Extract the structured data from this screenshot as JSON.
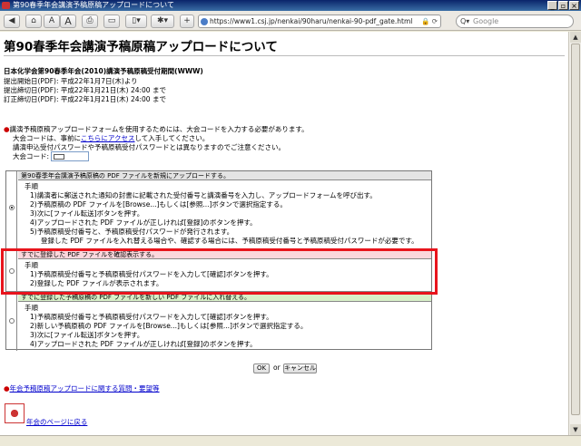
{
  "window": {
    "title": "第90春季年会講演予稿原稿アップロードについて",
    "controls": [
      "_",
      "▫",
      "×"
    ]
  },
  "toolbar": {
    "back": "◀",
    "home": "⌂",
    "font_small": "A",
    "font_large": "A",
    "print": "⎙",
    "bookmarks": "▭",
    "page": "▯▾",
    "settings": "✱▾",
    "add": "+",
    "url": "https://www1.csj.jp/nenkai/90haru/nenkai-90-pdf_gate.html",
    "url_right": "🔒 ⟳",
    "search_placeholder": "Google",
    "search_icon": "Q▾"
  },
  "page": {
    "title": "第90春季年会講演予稿原稿アップロードについて",
    "period_heading": "日本化学会第90春季年会(2010)講演予稿原稿受付期間(WWW)",
    "period_lines": [
      "提出開始日(PDF): 平成22年1月7日(木)より",
      "提出締切日(PDF): 平成22年1月21日(木) 24:00 まで",
      "訂正締切日(PDF): 平成22年1月21日(木) 24:00 まで"
    ],
    "notice_line1": "講演予稿原稿アップロードフォームを使用するためには、大会コードを入力する必要があります。",
    "notice_line2_pre": "大会コードは、事前に",
    "notice_line2_link": "こちらにアクセス",
    "notice_line2_post": "して入手してください。",
    "notice_line3": "講演申込受付パスワードや予稿原稿受付パスワードとは異なりますのでご注意ください。",
    "code_label": "大会コード:",
    "options": [
      {
        "header": "第90春季年会講演予稿原稿の PDF ファイルを新規にアップロードする。",
        "steps_title": "手順",
        "steps": [
          "1)講演者に郵送された通知の封書に記載された受付番号と講演番号を入力し、アップロードフォームを呼び出す。",
          "2)予稿原稿の PDF ファイルを[Browse...]もしくは[参照...]ボタンで選択指定する。",
          "3)次に[ファイル転送]ボタンを押す。",
          "4)アップロードされた PDF ファイルが正しければ[登録]のボタンを押す。",
          "5)予稿原稿受付番号と、予稿原稿受付パスワードが発行されます。",
          "登録した PDF ファイルを入れ替える場合や、確認する場合には、予稿原稿受付番号と予稿原稿受付パスワードが必要です。"
        ],
        "selected": true
      },
      {
        "header": "すでに登録した PDF ファイルを確認表示する。",
        "steps_title": "手順",
        "steps": [
          "1)予稿原稿受付番号と予稿原稿受付パスワードを入力して[確認]ボタンを押す。",
          "2)登録した PDF ファイルが表示されます。"
        ],
        "selected": false
      },
      {
        "header": "すでに登録した予稿原稿の PDF ファイルを新しい PDF ファイルに入れ替える。",
        "steps_title": "手順",
        "steps": [
          "1)予稿原稿受付番号と予稿原稿受付パスワードを入力して[確認]ボタンを押す。",
          "2)新しい予稿原稿の PDF ファイルを[Browse...]もしくは[参照...]ボタンで選択指定する。",
          "3)次に[ファイル転送]ボタンを押す。",
          "4)アップロードされた PDF ファイルが正しければ[登録]のボタンを押す。"
        ],
        "selected": false
      }
    ],
    "ok_label": "OK",
    "or_label": "or",
    "cancel_label": "キャンセル",
    "faq_link": "年会予稿原稿アップロードに関する質問・要望等",
    "back_link": "年会のページに戻る"
  }
}
